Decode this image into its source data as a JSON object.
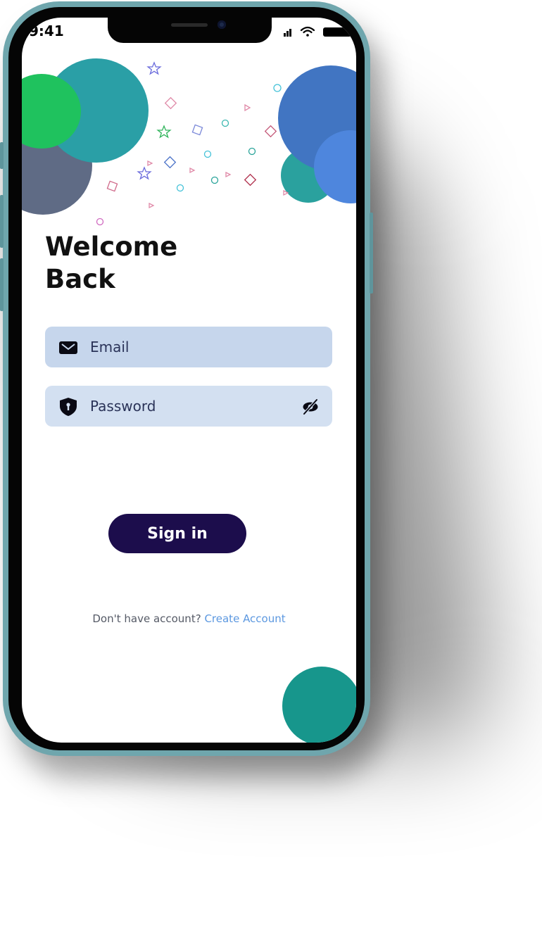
{
  "status_bar": {
    "time": "9:41"
  },
  "header": {
    "title_line1": "Welcome",
    "title_line2": "Back"
  },
  "form": {
    "email_placeholder": "Email",
    "password_placeholder": "Password",
    "email_icon": "mail-icon",
    "password_icon": "shield-icon",
    "visibility_icon": "eye-off-icon"
  },
  "actions": {
    "sign_in_label": "Sign in"
  },
  "footer": {
    "prompt": "Don't have account?",
    "link_label": "Create Account"
  },
  "colors": {
    "button": "#1c0d4c",
    "link": "#5c98e0",
    "field_email": "#c6d6ec",
    "field_password": "#d3e0f1",
    "blob_teal": "#2a9fa6",
    "blob_green": "#1fc25e",
    "blob_slate": "#5f6b85",
    "blob_blue": "#4175c2",
    "blob_light_blue": "#4e86dd",
    "blob_bottom_teal": "#17968c",
    "phone_frame": "#6fa6ad"
  }
}
